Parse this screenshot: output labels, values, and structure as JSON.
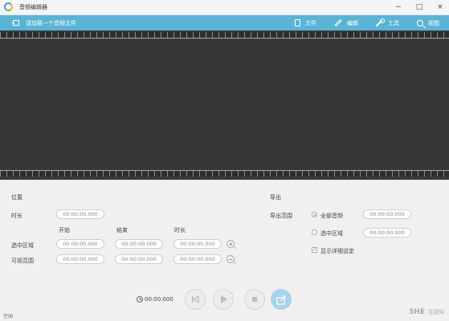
{
  "window": {
    "title": "音频编辑器",
    "controls": [
      "−",
      "□",
      "×"
    ]
  },
  "toolbar": {
    "add_file": "请加载一个音频文件",
    "file": "文件",
    "edit": "编辑",
    "tools": "工具",
    "view": "视图"
  },
  "position": {
    "section_title": "位置",
    "duration_label": "时长",
    "duration_value": "00:00:00.000",
    "col_start": "开始",
    "col_end": "结束",
    "col_length": "时长",
    "selection_label": "选中区域",
    "selection": [
      "00:00:00.000",
      "00:00:00.000",
      "00:00:00.000"
    ],
    "visible_label": "可视范围",
    "visible": [
      "00:00:00.000",
      "00:00:00.000",
      "00:00:00.000"
    ]
  },
  "export": {
    "section_title": "导出",
    "range_label": "导出范围",
    "all_audio": "全部音频",
    "all_audio_value": "00:00:00.000",
    "all_audio_selected": true,
    "selected_region": "选中区域",
    "selected_region_value": "00:00:00.000",
    "show_details": "显示详细设定",
    "show_details_checked": true
  },
  "player": {
    "time": "00:00.000"
  },
  "status": {
    "text": "空闲"
  },
  "watermark": {
    "brand": "3HE",
    "name": "当游网"
  }
}
